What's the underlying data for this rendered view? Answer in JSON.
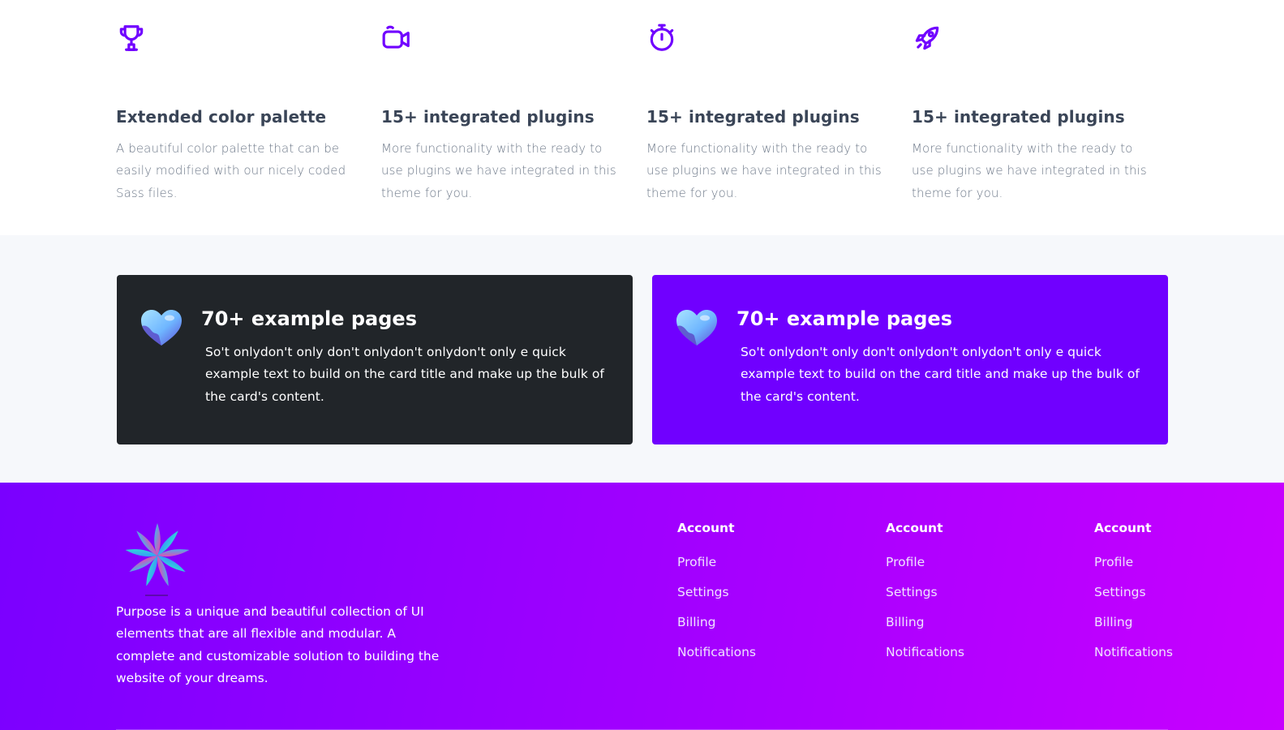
{
  "features": [
    {
      "icon": "trophy-icon",
      "title": "Extended color palette",
      "text": "A beautiful color palette that can be easily modified with our nicely coded Sass files."
    },
    {
      "icon": "video-camera-icon",
      "title": "15+ integrated plugins",
      "text": "More functionality with the ready to use plugins we have integrated in this theme for you."
    },
    {
      "icon": "stopwatch-icon",
      "title": "15+ integrated plugins",
      "text": "More functionality with the ready to use plugins we have integrated in this theme for you."
    },
    {
      "icon": "rocket-icon",
      "title": "15+ integrated plugins",
      "text": "More functionality with the ready to use plugins we have integrated in this theme for you."
    }
  ],
  "cards": [
    {
      "icon": "heart-icon",
      "title": "70+ example pages",
      "text": "So't onlydon't only don't onlydon't onlydon't only e quick example text to build on the card title and make up the bulk of the card's content.",
      "background": "#212529"
    },
    {
      "icon": "heart-icon",
      "title": "70+ example pages",
      "text": "So't onlydon't only don't onlydon't onlydon't only e quick example text to build on the card title and make up the bulk of the card's content.",
      "background": "#7000ff"
    }
  ],
  "footer": {
    "logo_icon": "flower-logo-icon",
    "description": "Purpose is a unique and beautiful collection of UI elements that are all flexible and modular. A complete and customizable solution to building the website of your dreams.",
    "columns": [
      {
        "heading": "Account",
        "links": [
          "Profile",
          "Settings",
          "Billing",
          "Notifications"
        ]
      },
      {
        "heading": "Account",
        "links": [
          "Profile",
          "Settings",
          "Billing",
          "Notifications"
        ]
      },
      {
        "heading": "Account",
        "links": [
          "Profile",
          "Settings",
          "Billing",
          "Notifications"
        ]
      }
    ]
  },
  "colors": {
    "accent": "#7000ff",
    "dark_card": "#212529",
    "heading": "#3a4557",
    "body_text": "#6f7a8a",
    "band_background": "#f6f8fb"
  }
}
